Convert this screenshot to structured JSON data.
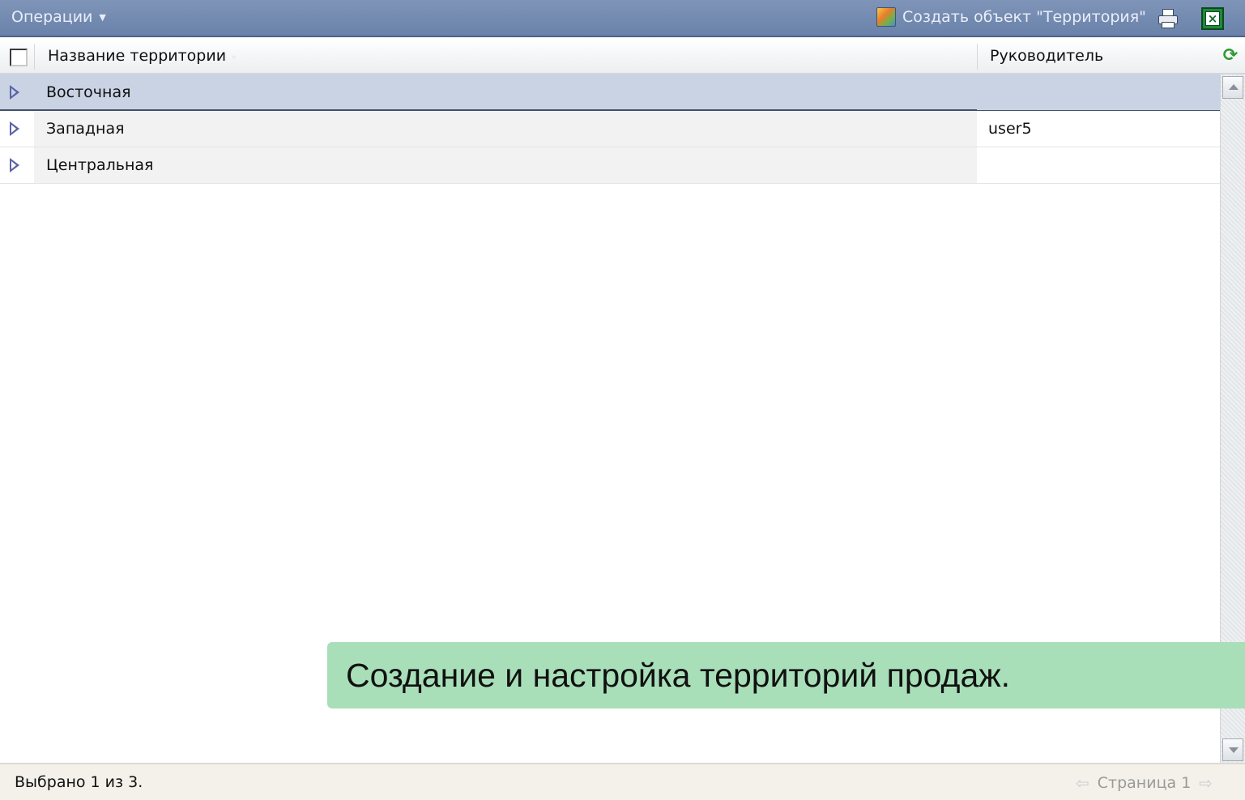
{
  "toolbar": {
    "operations_label": "Операции",
    "create_label": "Создать объект \"Территория\""
  },
  "header": {
    "name_col": "Название территории",
    "lead_col": "Руководитель"
  },
  "rows": [
    {
      "name": "Восточная",
      "lead": "",
      "selected": true
    },
    {
      "name": "Западная",
      "lead": "user5",
      "selected": false
    },
    {
      "name": "Центральная",
      "lead": "",
      "selected": false
    }
  ],
  "caption": "Создание и настройка территорий продаж.",
  "status": {
    "selection_text": "Выбрано 1 из 3.",
    "page_label": "Страница 1"
  },
  "icons": {
    "operations_caret": "caret-down-icon",
    "create": "create-territory-icon",
    "print": "printer-icon",
    "export": "excel-icon",
    "refresh": "refresh-icon",
    "expand": "expand-arrow-icon",
    "prev": "prev-page-arrow-icon",
    "next": "next-page-arrow-icon"
  },
  "colors": {
    "toolbar_bg": "#7088af",
    "selected_row_bg": "#c9d3e4",
    "caption_bg": "#a8dfb9",
    "status_bg": "#f3f1ea"
  }
}
